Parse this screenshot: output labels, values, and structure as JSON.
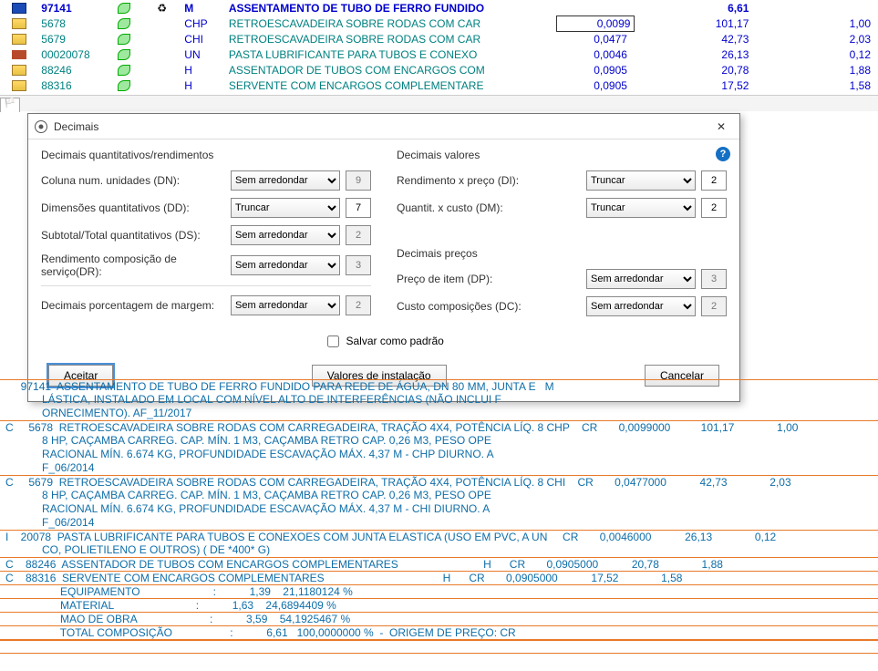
{
  "top_grid": {
    "rows": [
      {
        "icon": "blue",
        "code": "97141",
        "leaf": true,
        "unit": "M",
        "desc": "ASSENTAMENTO DE TUBO DE FERRO FUNDIDO",
        "q": "",
        "v1": "6,61",
        "v2": "",
        "bold": true
      },
      {
        "icon": "folder",
        "code": "5678",
        "leaf": true,
        "unit": "CHP",
        "desc": "RETROESCAVADEIRA SOBRE RODAS COM CAR",
        "q": "0,0099",
        "v1": "101,17",
        "v2": "1,00",
        "boxed": true
      },
      {
        "icon": "folder",
        "code": "5679",
        "leaf": true,
        "unit": "CHI",
        "desc": "RETROESCAVADEIRA SOBRE RODAS COM CAR",
        "q": "0,0477",
        "v1": "42,73",
        "v2": "2,03"
      },
      {
        "icon": "brick",
        "code": "00020078",
        "leaf": true,
        "unit": "UN",
        "desc": "PASTA LUBRIFICANTE PARA TUBOS E CONEXO",
        "q": "0,0046",
        "v1": "26,13",
        "v2": "0,12"
      },
      {
        "icon": "folder",
        "code": "88246",
        "leaf": true,
        "unit": "H",
        "desc": "ASSENTADOR DE TUBOS COM ENCARGOS COM",
        "q": "0,0905",
        "v1": "20,78",
        "v2": "1,88"
      },
      {
        "icon": "folder",
        "code": "88316",
        "leaf": true,
        "unit": "H",
        "desc": "SERVENTE COM ENCARGOS COMPLEMENTARE",
        "q": "0,0905",
        "v1": "17,52",
        "v2": "1,58"
      }
    ]
  },
  "dialog": {
    "title": "Decimais",
    "left": {
      "heading": "Decimais quantitativos/rendimentos",
      "rows": [
        {
          "label": "Coluna num. unidades (DN):",
          "combo": "Sem arredondar",
          "value": "9",
          "disabled": true
        },
        {
          "label": "Dimensões quantitativos (DD):",
          "combo": "Truncar",
          "value": "7",
          "disabled": false
        },
        {
          "label": "Subtotal/Total quantitativos (DS):",
          "combo": "Sem arredondar",
          "value": "2",
          "disabled": true
        },
        {
          "label": "Rendimento composição de serviço(DR):",
          "combo": "Sem arredondar",
          "value": "3",
          "disabled": true
        }
      ],
      "margin_label": "Decimais porcentagem de margem:",
      "margin_combo": "Sem arredondar",
      "margin_value": "2"
    },
    "right": {
      "heading1": "Decimais valores",
      "rows1": [
        {
          "label": "Rendimento x preço (DI):",
          "combo": "Truncar",
          "value": "2"
        },
        {
          "label": "Quantit. x custo (DM):",
          "combo": "Truncar",
          "value": "2"
        }
      ],
      "heading2": "Decimais preços",
      "rows2": [
        {
          "label": "Preço de item (DP):",
          "combo": "Sem arredondar",
          "value": "3",
          "disabled": true
        },
        {
          "label": "Custo composições (DC):",
          "combo": "Sem arredondar",
          "value": "2",
          "disabled": true
        }
      ]
    },
    "save_default": "Salvar como padrão",
    "accept": "Aceitar",
    "install_values": "Valores de instalação",
    "cancel": "Cancelar"
  },
  "combo_options": [
    "Sem arredondar",
    "Truncar"
  ],
  "listing": [
    {
      "t": "     97141  ASSENTAMENTO DE TUBO DE FERRO FUNDIDO PARA REDE DE ÁGUA, DN 80 MM, JUNTA E   M",
      "top": true
    },
    {
      "t": "            LÁSTICA, INSTALADO EM LOCAL COM NÍVEL ALTO DE INTERFERÊNCIAS (NÃO INCLUI F",
      "cont": true
    },
    {
      "t": "            ORNECIMENTO). AF_11/2017",
      "cont": true
    },
    {
      "t": "C     5678  RETROESCAVADEIRA SOBRE RODAS COM CARREGADEIRA, TRAÇÃO 4X4, POTÊNCIA LÍQ. 8 CHP    CR       0,0099000          101,17              1,00"
    },
    {
      "t": "            8 HP, CAÇAMBA CARREG. CAP. MÍN. 1 M3, CAÇAMBA RETRO CAP. 0,26 M3, PESO OPE",
      "cont": true
    },
    {
      "t": "            RACIONAL MÍN. 6.674 KG, PROFUNDIDADE ESCAVAÇÃO MÁX. 4,37 M - CHP DIURNO. A",
      "cont": true
    },
    {
      "t": "            F_06/2014",
      "cont": true
    },
    {
      "t": "C     5679  RETROESCAVADEIRA SOBRE RODAS COM CARREGADEIRA, TRAÇÃO 4X4, POTÊNCIA LÍQ. 8 CHI    CR       0,0477000           42,73              2,03"
    },
    {
      "t": "            8 HP, CAÇAMBA CARREG. CAP. MÍN. 1 M3, CAÇAMBA RETRO CAP. 0,26 M3, PESO OPE",
      "cont": true
    },
    {
      "t": "            RACIONAL MÍN. 6.674 KG, PROFUNDIDADE ESCAVAÇÃO MÁX. 4,37 M - CHI DIURNO. A",
      "cont": true
    },
    {
      "t": "            F_06/2014",
      "cont": true
    },
    {
      "t": "I    20078  PASTA LUBRIFICANTE PARA TUBOS E CONEXOES COM JUNTA ELASTICA (USO EM PVC, A UN     CR       0,0046000           26,13              0,12"
    },
    {
      "t": "            CO, POLIETILENO E OUTROS) ( DE *400* G)",
      "cont": true
    },
    {
      "t": "C    88246  ASSENTADOR DE TUBOS COM ENCARGOS COMPLEMENTARES                            H      CR       0,0905000           20,78              1,88"
    },
    {
      "t": "C    88316  SERVENTE COM ENCARGOS COMPLEMENTARES                                       H      CR       0,0905000           17,52              1,58"
    },
    {
      "t": "                  EQUIPAMENTO                        :           1,39    21,1180124 %"
    },
    {
      "t": "                  MATERIAL                           :           1,63    24,6894409 %"
    },
    {
      "t": "                  MAO DE OBRA                        :           3,59    54,1925467 %"
    },
    {
      "t": "                  TOTAL COMPOSIÇÃO                   :           6,61   100,0000000 %  -  ORIGEM DE PREÇO: CR"
    },
    {
      "t": "",
      "bold": true
    },
    {
      "t": ""
    }
  ]
}
